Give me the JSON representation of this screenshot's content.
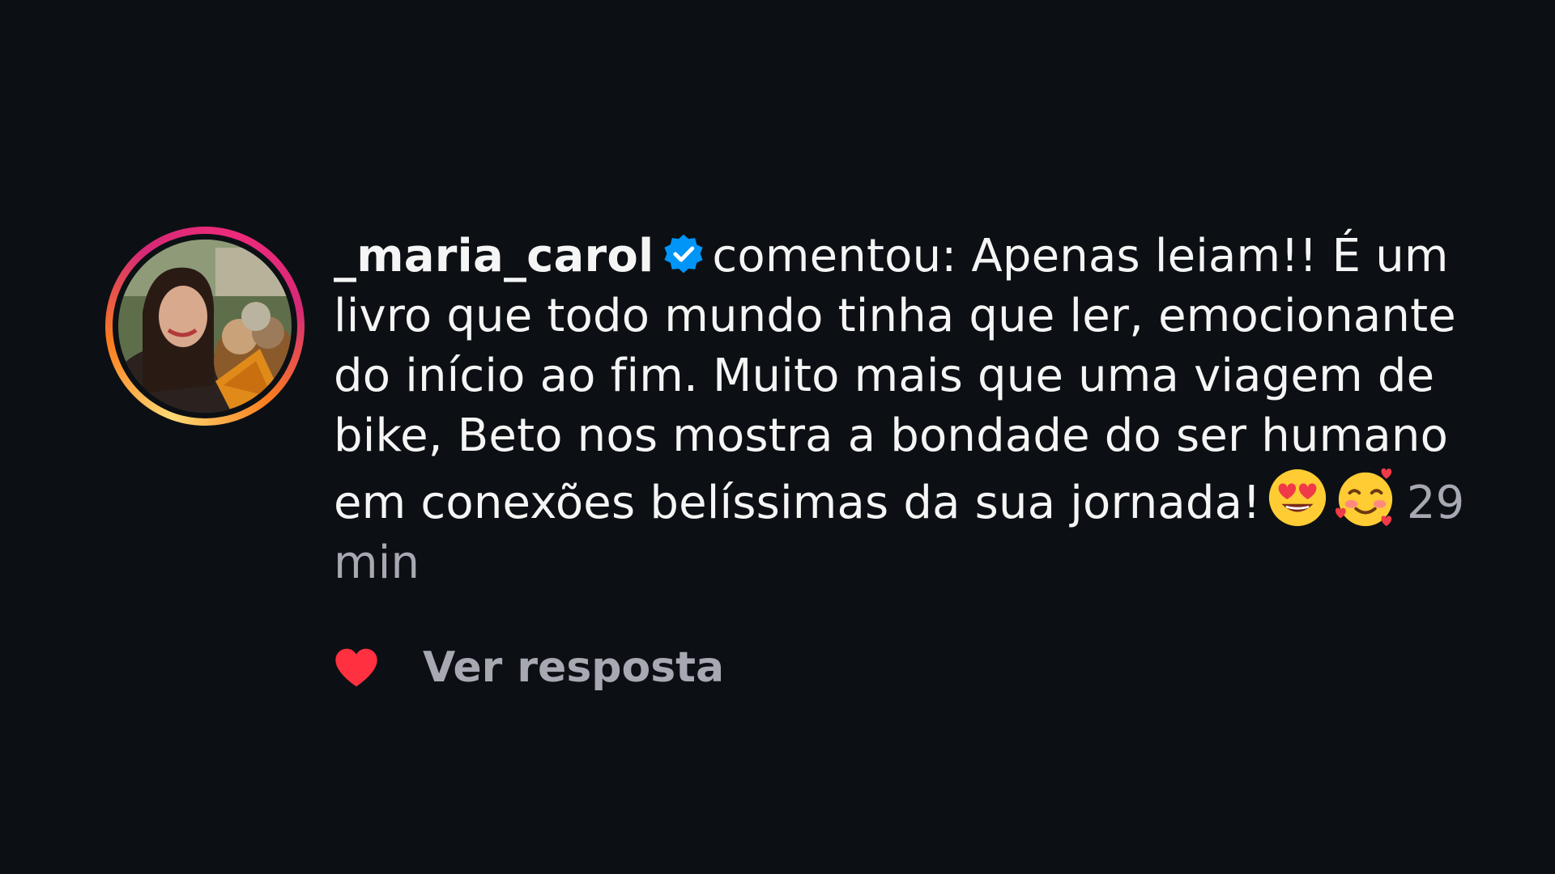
{
  "notification": {
    "username": "_maria_carol",
    "verified_icon": "verified-badge-icon",
    "action_text": "comentou:",
    "comment_text": "Apenas leiam!! É um livro que todo mundo tinha que ler, emocionante do início ao fim. Muito mais que uma viagem de bike, Beto nos mostra a bondade do ser humano em conexões belíssimas da sua jornada!",
    "emojis": [
      "heart-eyes-emoji",
      "smiling-face-with-hearts-emoji"
    ],
    "timestamp": "29 min",
    "like_icon": "heart-icon",
    "reply_label": "Ver resposta"
  },
  "colors": {
    "background": "#0c1014",
    "text": "#f5f5f5",
    "muted": "#a8a8b3",
    "verified": "#0095f6",
    "like": "#ff3040"
  }
}
